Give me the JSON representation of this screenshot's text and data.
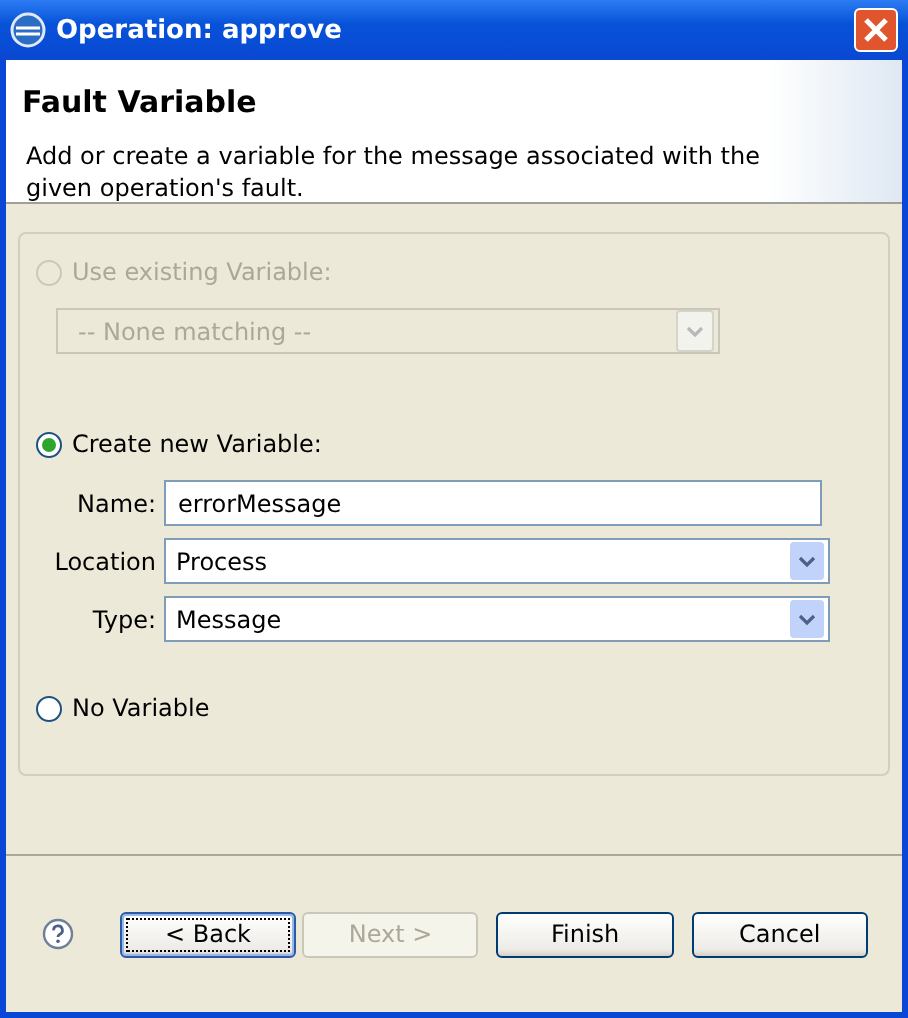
{
  "window": {
    "title": "Operation: approve"
  },
  "header": {
    "title": "Fault Variable",
    "description": "Add or create a variable for the message associated with the given operation's fault."
  },
  "options": [
    {
      "kind": "existing",
      "label": "Use existing Variable:",
      "selected": false,
      "disabled": true,
      "combo": {
        "value": "-- None matching --"
      }
    },
    {
      "kind": "create",
      "label": "Create new Variable:",
      "selected": true,
      "disabled": false,
      "fields": [
        {
          "kind": "text",
          "label": "Name:",
          "value": "errorMessage"
        },
        {
          "kind": "combo",
          "label": "Location",
          "value": "Process"
        },
        {
          "kind": "combo",
          "label": "Type:",
          "value": "Message"
        }
      ]
    },
    {
      "kind": "none",
      "label": "No Variable",
      "selected": false,
      "disabled": false
    }
  ],
  "buttons": [
    {
      "label": "< Back",
      "disabled": false,
      "focused": true
    },
    {
      "label": "Next >",
      "disabled": true,
      "focused": false
    },
    {
      "label": "Finish",
      "disabled": false,
      "focused": false
    },
    {
      "label": "Cancel",
      "disabled": false,
      "focused": false
    }
  ]
}
